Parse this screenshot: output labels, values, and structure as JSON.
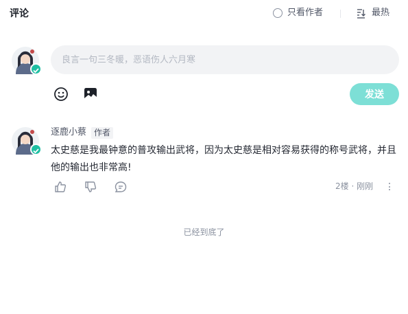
{
  "header": {
    "title": "评论",
    "only_author_label": "只看作者",
    "sort_label": "最热"
  },
  "editor": {
    "placeholder": "良言一句三冬暖，恶语伤人六月寒",
    "send_label": "发送"
  },
  "comments": [
    {
      "author": "逐鹿小蔡",
      "badge": "作者",
      "content": "太史慈是我最钟意的普攻输出武将，因为太史慈是相对容易获得的称号武将，并且他的输出也非常高!",
      "meta": "2楼 · 刚刚"
    }
  ],
  "footer": {
    "end_text": "已经到底了"
  },
  "colors": {
    "accent": "#1fbfa3",
    "send_button": "#7ddfd6",
    "input_bg": "#f2f3f5"
  }
}
